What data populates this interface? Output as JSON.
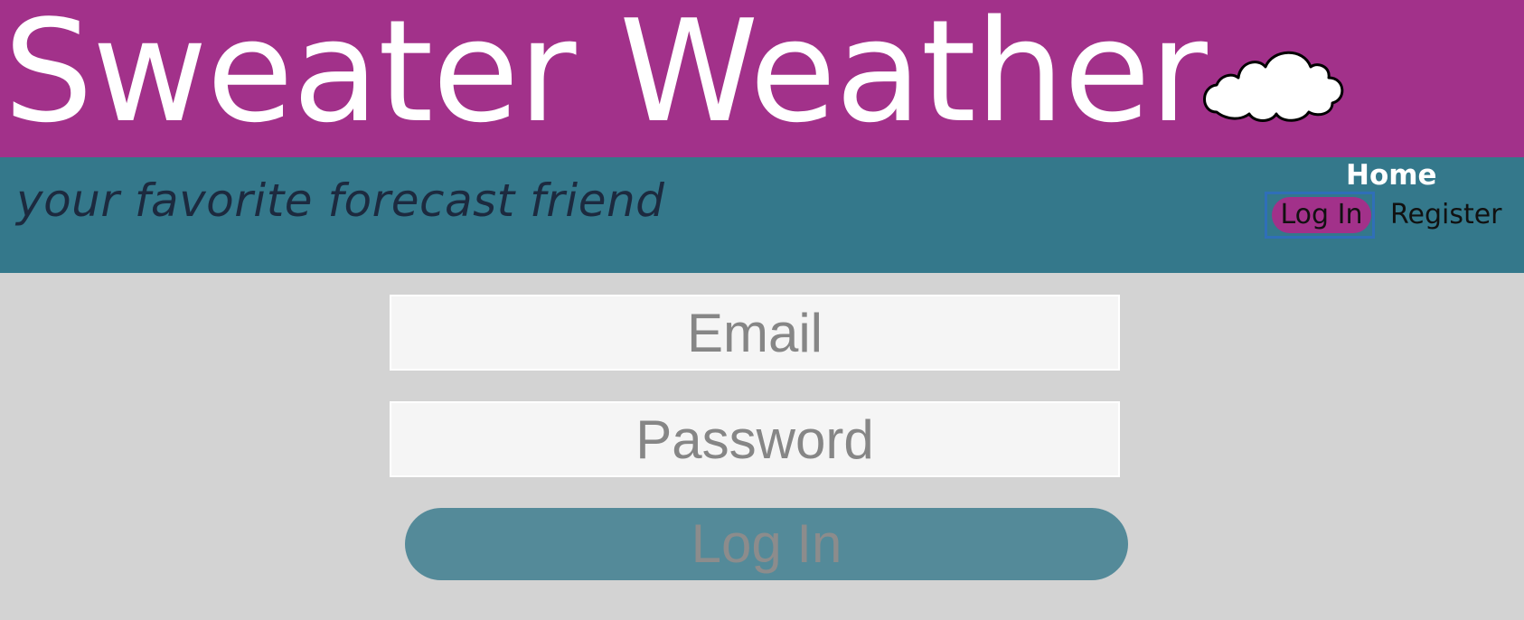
{
  "header": {
    "title": "Sweater Weather",
    "logo_icon": "cloud-icon",
    "tagline": "your favorite forecast friend"
  },
  "nav": {
    "home_label": "Home",
    "login_label": "Log In",
    "register_label": "Register"
  },
  "form": {
    "email_placeholder": "Email",
    "password_placeholder": "Password",
    "submit_label": "Log In"
  },
  "colors": {
    "banner": "#a2318a",
    "subbar": "#34788b",
    "background": "#d3d3d3",
    "button": "#548a99"
  }
}
